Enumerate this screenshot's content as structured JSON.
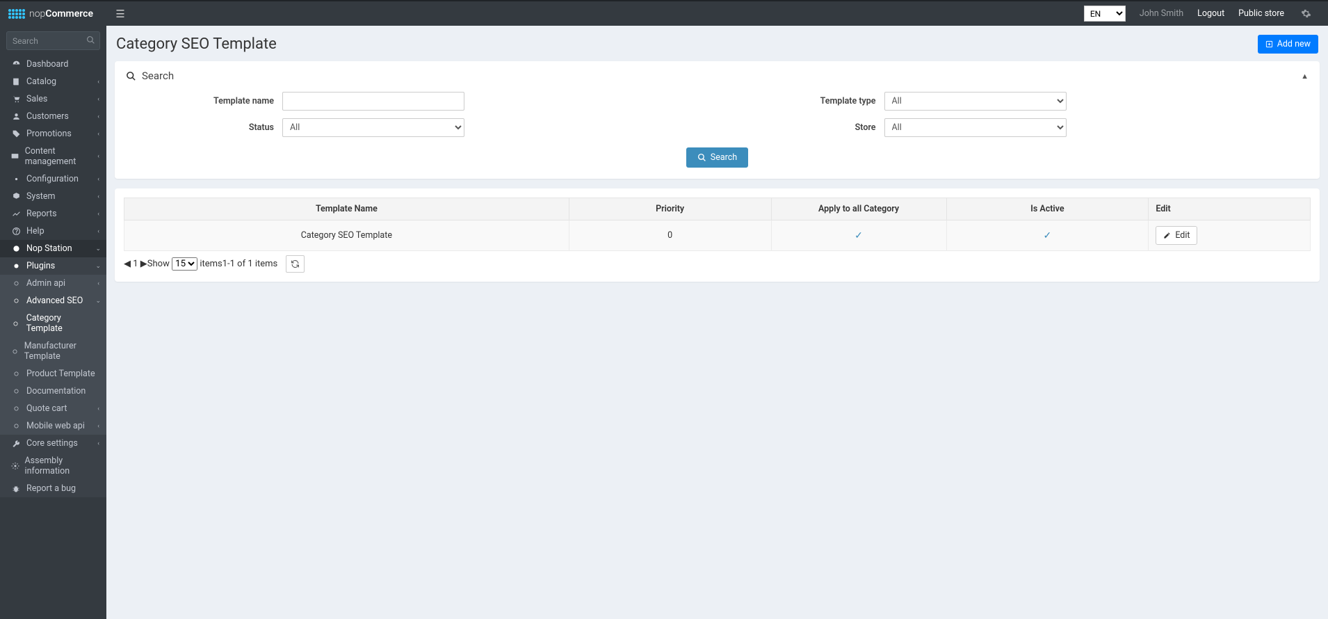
{
  "brand": {
    "nop": "nop",
    "commerce": "Commerce"
  },
  "topbar": {
    "lang_options": [
      "EN"
    ],
    "lang_selected": "EN",
    "user": "John Smith",
    "logout": "Logout",
    "public_store": "Public store"
  },
  "sidebar": {
    "search_placeholder": "Search",
    "items": [
      {
        "label": "Dashboard",
        "icon": "tach",
        "has_children": false
      },
      {
        "label": "Catalog",
        "icon": "tags",
        "has_children": true
      },
      {
        "label": "Sales",
        "icon": "cart",
        "has_children": true
      },
      {
        "label": "Customers",
        "icon": "user",
        "has_children": true
      },
      {
        "label": "Promotions",
        "icon": "tag",
        "has_children": true
      },
      {
        "label": "Content management",
        "icon": "cms",
        "has_children": true
      },
      {
        "label": "Configuration",
        "icon": "cog",
        "has_children": true
      },
      {
        "label": "System",
        "icon": "cube",
        "has_children": true
      },
      {
        "label": "Reports",
        "icon": "chart",
        "has_children": true
      },
      {
        "label": "Help",
        "icon": "help",
        "has_children": true
      },
      {
        "label": "Nop Station",
        "icon": "dot",
        "has_children": true,
        "active": true
      }
    ],
    "nopstation": {
      "plugins": "Plugins",
      "admin_api": "Admin api",
      "advanced_seo": "Advanced SEO",
      "seo_children": [
        {
          "label": "Category Template",
          "active": true
        },
        {
          "label": "Manufacturer Template"
        },
        {
          "label": "Product Template"
        },
        {
          "label": "Documentation"
        }
      ],
      "quote_cart": "Quote cart",
      "mobile_web_api": "Mobile web api",
      "core_settings": "Core settings",
      "assembly_info": "Assembly information",
      "report_bug": "Report a bug"
    }
  },
  "page_title": "Category SEO Template",
  "add_new": "Add new",
  "search_card": {
    "title": "Search",
    "template_name": "Template name",
    "status": "Status",
    "template_type": "Template type",
    "store": "Store",
    "all": "All",
    "search_btn": "Search"
  },
  "table": {
    "headers": [
      "Template Name",
      "Priority",
      "Apply to all Category",
      "Is Active",
      "Edit"
    ],
    "rows": [
      {
        "name": "Category SEO Template",
        "priority": "0",
        "apply_all": true,
        "is_active": true
      }
    ],
    "edit_label": "Edit",
    "show": "Show",
    "items": "items",
    "page_size": "15",
    "info": "1-1 of 1 items",
    "current_page": "1"
  }
}
